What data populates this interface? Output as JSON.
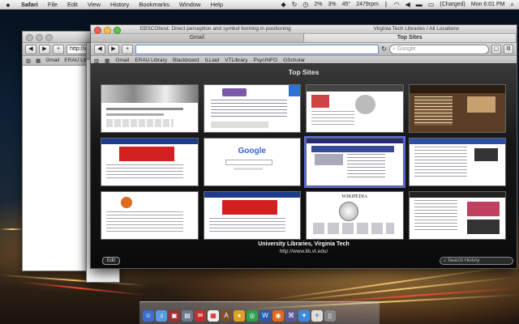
{
  "menubar": {
    "apple": "",
    "items": [
      "Safari",
      "File",
      "Edit",
      "View",
      "History",
      "Bookmarks",
      "Window",
      "Help"
    ],
    "status": {
      "cpu": "2%",
      "disk": "3%",
      "temp": "45°",
      "fan": "2479rpm",
      "battery": "(Charged)",
      "datetime": "Mon 6:01 PM"
    }
  },
  "back_window_1": {
    "url": "http://www",
    "bookmarks": [
      "Gmail",
      "ERAU Library"
    ]
  },
  "front_window": {
    "title": "EBSCOhost: Direct perception and symbol forming in positioning",
    "title_right": "Virginia Tech Libraries / All Locations",
    "tabs": [
      "Gmail",
      "Top Sites"
    ],
    "search_placeholder": "Google",
    "bookmarks": [
      "Gmail",
      "ERAU Library",
      "Blackboard",
      "ILLiad",
      "VTLibrary",
      "PsycINFO",
      "GScholar"
    ]
  },
  "top_sites": {
    "heading": "Top Sites",
    "caption_title": "University Libraries, Virginia Tech",
    "caption_url": "http://www.lib.vt.edu/",
    "edit_label": "Edit",
    "search_history_placeholder": "Search History",
    "thumb_texts": [
      "Google",
      "WIKIPEDIA"
    ]
  },
  "dock": {
    "icons": [
      "finder-icon",
      "itunes-icon",
      "photo-icon",
      "preview-icon",
      "mail-icon",
      "calendar-icon",
      "dictionary-icon",
      "ball-icon",
      "chrome-icon",
      "word-icon",
      "firefox-icon",
      "network-icon",
      "safari-icon",
      "light-icon",
      "trash-icon"
    ]
  }
}
